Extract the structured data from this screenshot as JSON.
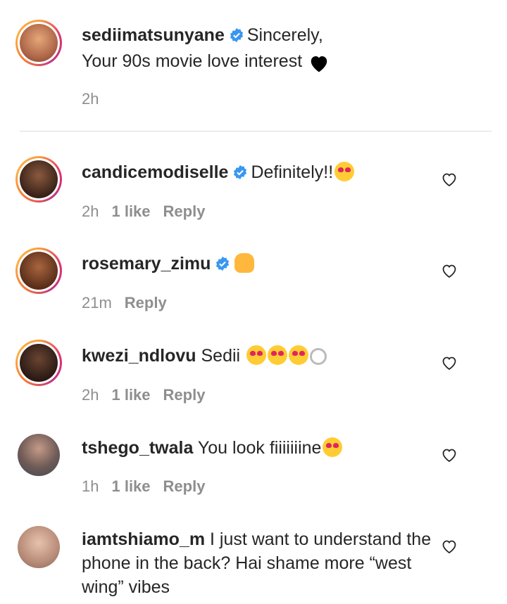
{
  "caption": {
    "username": "sediimatsunyane",
    "text": "Sincerely,",
    "text2": "Your 90s movie love interest",
    "emoji": "black-heart",
    "time": "2h"
  },
  "comments": [
    {
      "username": "candicemodiselle",
      "verified": true,
      "text": "Definitely!!",
      "emojis": [
        "smiling-face-with-heart-eyes"
      ],
      "time": "2h",
      "likes": "1 like",
      "reply": "Reply",
      "avatar_color": "#5a3a2a"
    },
    {
      "username": "rosemary_zimu",
      "verified": true,
      "text": "",
      "emojis": [
        "raising-hands"
      ],
      "time": "21m",
      "likes": "",
      "reply": "Reply",
      "avatar_color": "#7a4a30"
    },
    {
      "username": "kwezi_ndlovu",
      "verified": false,
      "text": "Sedii",
      "emojis": [
        "smiling-face-with-heart-eyes",
        "smiling-face-with-heart-eyes",
        "smiling-face-with-heart-eyes",
        "ring"
      ],
      "time": "2h",
      "likes": "1 like",
      "reply": "Reply",
      "avatar_color": "#4a3128"
    },
    {
      "username": "tshego_twala",
      "verified": false,
      "text": "You look fiiiiiiine",
      "emojis": [
        "smiling-face-with-heart-eyes"
      ],
      "time": "1h",
      "likes": "1 like",
      "reply": "Reply",
      "avatar_color": "#6d5a55"
    },
    {
      "username": "iamtshiamo_m",
      "verified": false,
      "text": "I just want to understand the phone in the back? Hai shame more “west wing” vibes",
      "emojis": [],
      "time": "",
      "likes": "",
      "reply": "",
      "avatar_color": "#c7a38e"
    }
  ],
  "colors": {
    "text": "#262626",
    "meta": "#8e8e8e",
    "verified": "#3897f0",
    "divider": "#dbdbdb"
  }
}
